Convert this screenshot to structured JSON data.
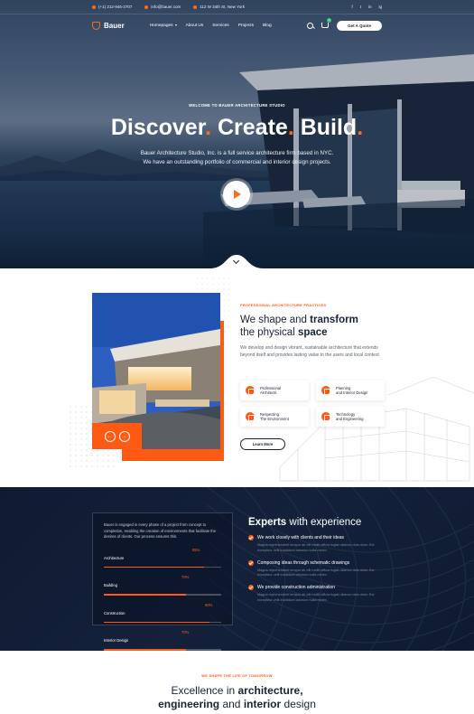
{
  "topbar": {
    "phone": "(+1) 212-946-2707",
    "email": "info@bauer.com",
    "address": "112 W 34th St, New York",
    "socials": [
      "f",
      "t",
      "in",
      "ig"
    ]
  },
  "nav": {
    "brand": "Bauer",
    "items": [
      "Homepages",
      "About Us",
      "Services",
      "Projects",
      "Blog"
    ],
    "cart_count": "0",
    "cta": "Get A Quote"
  },
  "hero": {
    "kicker": "WELCOME TO BAUER ARCHITECTURE STUDIO",
    "headline": [
      "Discover",
      "Create",
      "Build"
    ],
    "sub_line1": "Bauer Architecture Studio, Inc. is a full service architecture firm based in NYC.",
    "sub_line2": "We have an outstanding portfolio of commercial and interior design projects."
  },
  "about": {
    "kicker": "PROFESSIONAL ARCHITECTURE PRACTICES",
    "title_a": "We shape and ",
    "title_b": "transform",
    "title_c": "the physical ",
    "title_d": "space",
    "desc": "We develop and design vibrant, sustainable architecture that extends beyond itself and provides lasting value to the users and local context.",
    "features": [
      "Professional\nArchitects",
      "Planning\nand Interior Design",
      "Respecting\nThe Environment",
      "Technology\nand Engineering"
    ],
    "learn_more": "Learn More",
    "prev": "←",
    "next": "→"
  },
  "experts": {
    "card_text": "Bauer is engaged in every phase of a project from concept to completion, enabling the creation of environments that facilitate the desires of clients. Our process ensures this.",
    "skills": [
      {
        "name": "Architecture",
        "value": "85%",
        "pct": 85
      },
      {
        "name": "Building",
        "value": "70%",
        "pct": 70
      },
      {
        "name": "Construction",
        "value": "90%",
        "pct": 90
      },
      {
        "name": "Interior Design",
        "value": "70%",
        "pct": 70
      }
    ],
    "title_a": "Experts",
    "title_b": " with experience",
    "items": [
      {
        "title": "We work closely with clients and their ideas",
        "text": "Magna reprehenderit tempor ab elit mollit officia fugiat ullamco duis dolor. Est excepteur velit incididunt laborum nulla minim."
      },
      {
        "title": "Composing ideas through schematic drawings",
        "text": "Magna reprehenderit tempor ab elit mollit officia fugiat ullamco duis dolor. Est excepteur velit incididunt laborum nulla minim."
      },
      {
        "title": "We provide construction administration",
        "text": "Magna reprehenderit tempor ab elit mollit officia fugiat ullamco duis dolor. Est excepteur velit incididunt laborum nulla minim."
      }
    ]
  },
  "excellence": {
    "kicker": "WE SHAPE THE LIFE OF TOMORROW",
    "line1_a": "Excellence in ",
    "line1_b": "architecture,",
    "line2_a": "engineering",
    "line2_b": " and ",
    "line2_c": "interior",
    "line2_d": " design"
  },
  "colors": {
    "accent": "#ff5a14",
    "navy": "#14213b",
    "text": "#1a2236"
  }
}
